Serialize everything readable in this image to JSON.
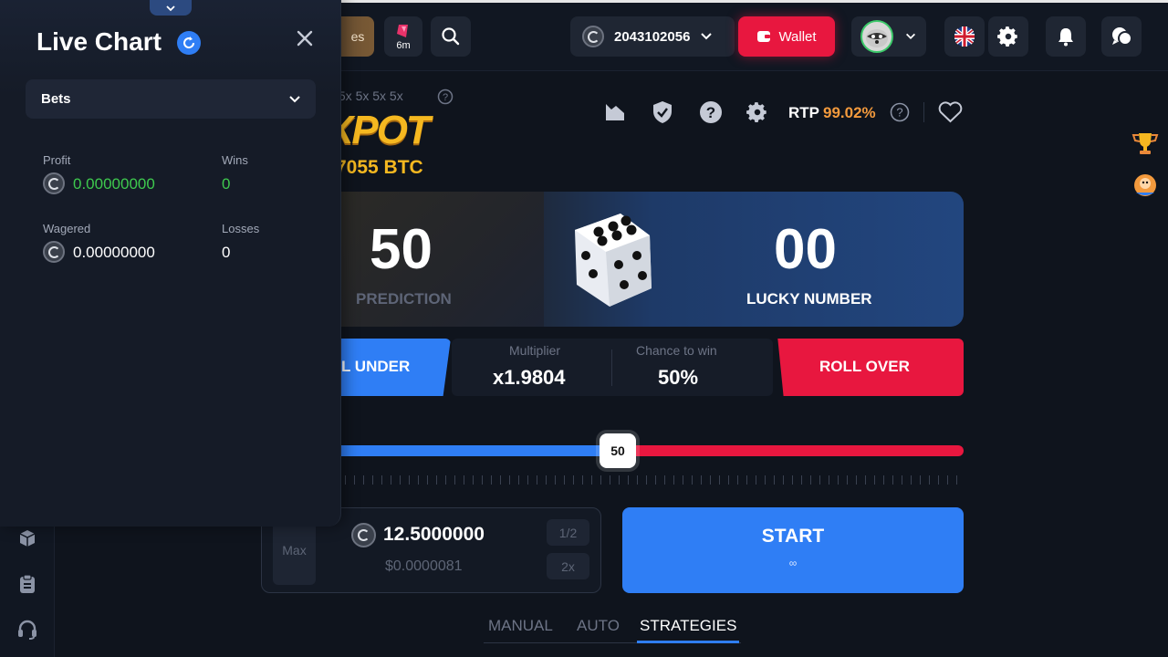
{
  "topbar": {
    "partial_label": "es",
    "timer_label": "6m",
    "balance": "2043102056",
    "wallet_label": "Wallet"
  },
  "game": {
    "multipliers_text": "x 5x 5x 5x 5x",
    "jackpot_word": "XPOT",
    "jackpot_amount": "7055 BTC",
    "rtp_label": "RTP",
    "rtp_value": "99.02%",
    "prediction_value": "50",
    "prediction_label": "PREDICTION",
    "lucky_value": "00",
    "lucky_label": "LUCKY NUMBER",
    "roll_under_label": "L UNDER",
    "multiplier_label": "Multiplier",
    "multiplier_value": "x1.9804",
    "chance_label": "Chance to win",
    "chance_value": "50%",
    "roll_over_label": "ROLL OVER",
    "slider_value": "50",
    "bet_max": "Max",
    "bet_amount": "12.5000000",
    "bet_usd": "$0.0000081",
    "half_label": "1/2",
    "double_label": "2x",
    "start_label": "START",
    "start_sub": "∞"
  },
  "tabs": [
    "MANUAL",
    "AUTO",
    "STRATEGIES"
  ],
  "active_tab": "STRATEGIES",
  "panel": {
    "title": "Live Chart",
    "select_value": "Bets",
    "profit_label": "Profit",
    "profit_value": "0.00000000",
    "wins_label": "Wins",
    "wins_value": "0",
    "wagered_label": "Wagered",
    "wagered_value": "0.00000000",
    "losses_label": "Losses",
    "losses_value": "0"
  },
  "colors": {
    "accent_blue": "#2f7ef5",
    "accent_red": "#e8173f",
    "profit_green": "#3ec94e",
    "rtp_orange": "#f39a3d",
    "jackpot_gold": "#f5b820"
  }
}
